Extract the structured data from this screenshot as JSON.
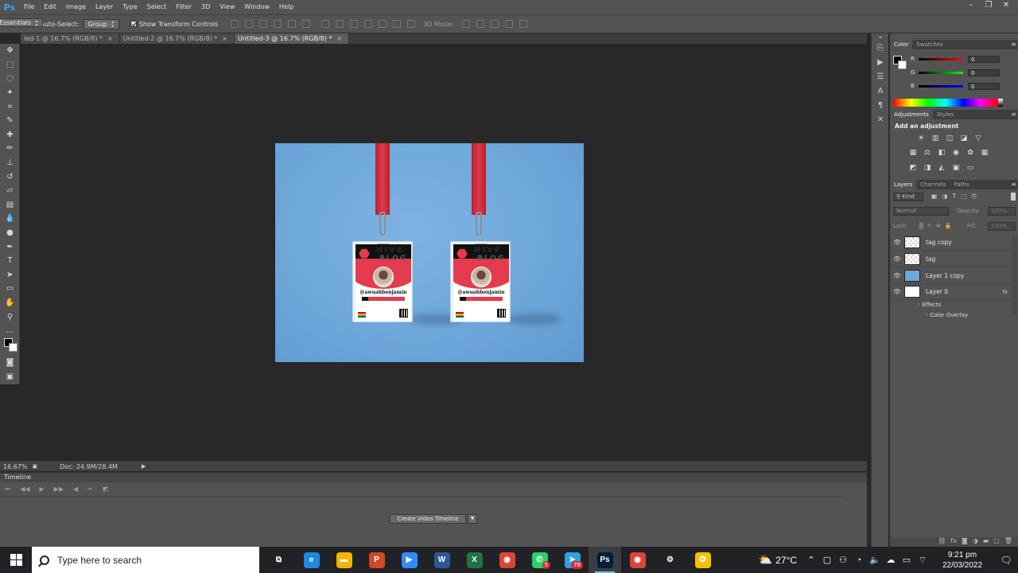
{
  "app": {
    "logo": "Ps"
  },
  "menu": [
    "File",
    "Edit",
    "Image",
    "Layer",
    "Type",
    "Select",
    "Filter",
    "3D",
    "View",
    "Window",
    "Help"
  ],
  "options": {
    "auto_select_label": "Auto-Select:",
    "auto_select_value": "Group",
    "show_transform_label": "Show Transform Controls",
    "mode_3d_label": "3D Mode:",
    "workspace": "Essentials"
  },
  "tabs": [
    {
      "label": "led-1 @ 16.7% (RGB/8) *",
      "active": false
    },
    {
      "label": "Untitled-2 @ 16.7% (RGB/8) *",
      "active": false
    },
    {
      "label": "Untitled-3 @ 16.7% (RGB/8) *",
      "active": true
    }
  ],
  "artwork": {
    "card_brand_line1": "HIVE",
    "card_brand_line2": "BLOG",
    "card_name": "@awuahbenjamin"
  },
  "status": {
    "zoom": "16.67%",
    "doc": "Doc: 24.9M/28.4M"
  },
  "timeline": {
    "title": "Timeline",
    "create_button": "Create Video Timeline"
  },
  "color_panel": {
    "tabs": [
      "Color",
      "Swatches"
    ],
    "r_label": "R",
    "g_label": "G",
    "b_label": "B",
    "r": "0",
    "g": "0",
    "b": "0"
  },
  "adjustments_panel": {
    "tabs": [
      "Adjustments",
      "Styles"
    ],
    "title": "Add an adjustment"
  },
  "layers_panel": {
    "tabs": [
      "Layers",
      "Channels",
      "Paths"
    ],
    "kind": "Kind",
    "blend_mode": "Normal",
    "opacity_label": "Opacity:",
    "opacity": "100%",
    "lock_label": "Lock:",
    "fill_label": "Fill:",
    "fill": "100%",
    "layers": [
      {
        "name": "tag copy",
        "thumb": "checker"
      },
      {
        "name": "tag",
        "thumb": "checker"
      },
      {
        "name": "Layer 1 copy",
        "thumb": "blue"
      },
      {
        "name": "Layer 0",
        "thumb": "white",
        "fx": "fx"
      }
    ],
    "effects_label": "Effects",
    "effect_color_overlay": "Color Overlay"
  },
  "taskbar": {
    "search_placeholder": "Type here to search",
    "apps": [
      {
        "id": "task-view",
        "glyph": "⧉",
        "color": "transparent"
      },
      {
        "id": "edge",
        "glyph": "e",
        "color": "#1e88e5"
      },
      {
        "id": "file-explorer",
        "glyph": "▬",
        "color": "#f4b400"
      },
      {
        "id": "powerpoint",
        "glyph": "P",
        "color": "#d24726"
      },
      {
        "id": "zoom",
        "glyph": "▶",
        "color": "#2d8cff"
      },
      {
        "id": "word",
        "glyph": "W",
        "color": "#2b579a"
      },
      {
        "id": "excel",
        "glyph": "X",
        "color": "#217346"
      },
      {
        "id": "chrome",
        "glyph": "◉",
        "color": "#db4437"
      },
      {
        "id": "whatsapp",
        "glyph": "✆",
        "color": "#25d366",
        "badge": "5"
      },
      {
        "id": "telegram",
        "glyph": "➤",
        "color": "#2aa3df",
        "badge": "78"
      },
      {
        "id": "photoshop",
        "glyph": "Ps",
        "color": "#001e36",
        "active": true
      },
      {
        "id": "chrome-2",
        "glyph": "◉",
        "color": "#db4437"
      },
      {
        "id": "settings",
        "glyph": "⚙",
        "color": "transparent"
      },
      {
        "id": "norton",
        "glyph": "✪",
        "color": "#f6c200"
      }
    ],
    "temperature": "27°C",
    "time": "9:21 pm",
    "date": "22/03/2022"
  }
}
